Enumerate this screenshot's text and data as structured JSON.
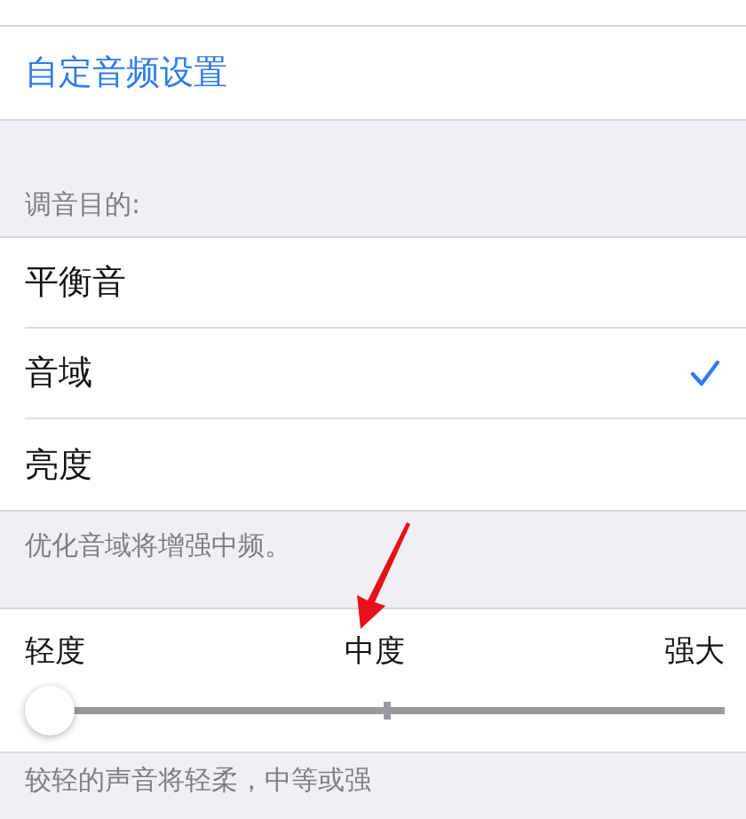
{
  "custom_link": {
    "label": "自定音频设置"
  },
  "tuning_section": {
    "header": "调音目的:",
    "options": [
      {
        "label": "平衡音",
        "selected": false
      },
      {
        "label": "音域",
        "selected": true
      },
      {
        "label": "亮度",
        "selected": false
      }
    ],
    "footer": "优化音域将增强中频。"
  },
  "strength": {
    "labels": [
      "轻度",
      "中度",
      "强大"
    ],
    "level": 0,
    "footer": "较轻的声音将轻柔，中等或强"
  }
}
